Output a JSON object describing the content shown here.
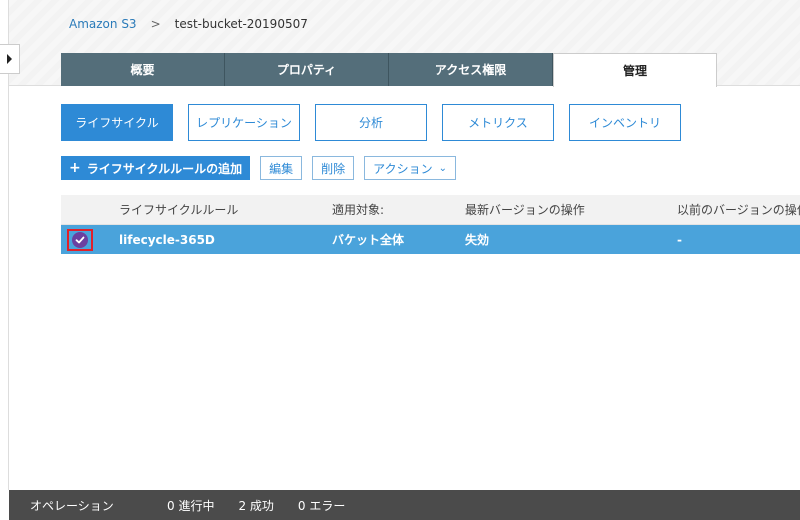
{
  "breadcrumb": {
    "root": "Amazon S3",
    "separator": ">",
    "current": "test-bucket-20190507"
  },
  "tabs": [
    {
      "label": "概要",
      "active": false
    },
    {
      "label": "プロパティ",
      "active": false
    },
    {
      "label": "アクセス権限",
      "active": false
    },
    {
      "label": "管理",
      "active": true
    }
  ],
  "subtabs": [
    {
      "label": "ライフサイクル",
      "active": true
    },
    {
      "label": "レプリケーション",
      "active": false
    },
    {
      "label": "分析",
      "active": false
    },
    {
      "label": "メトリクス",
      "active": false
    },
    {
      "label": "インベントリ",
      "active": false
    }
  ],
  "toolbar": {
    "add_rule_icon": "+",
    "add_rule_label": "ライフサイクルルールの追加",
    "edit_label": "編集",
    "delete_label": "削除",
    "action_label": "アクション",
    "action_chevron": "⌄"
  },
  "table": {
    "headers": {
      "name": "ライフサイクルルール",
      "scope": "適用対象:",
      "current_version": "最新バージョンの操作",
      "previous_version": "以前のバージョンの操作"
    },
    "rows": [
      {
        "selected": true,
        "name": "lifecycle-365D",
        "scope": "バケット全体",
        "current_version": "失効",
        "previous_version": "-"
      }
    ]
  },
  "statusbar": {
    "label": "オペレーション",
    "in_progress": "0 進行中",
    "success": "2 成功",
    "errors": "0 エラー"
  },
  "colors": {
    "tab_bg": "#546e7a",
    "accent_blue": "#2e8ad6",
    "selected_row": "#4aa3db",
    "checkbox_fill": "#6b3fa0",
    "highlight_red": "#e0202a",
    "statusbar_bg": "#4b4b4b"
  }
}
